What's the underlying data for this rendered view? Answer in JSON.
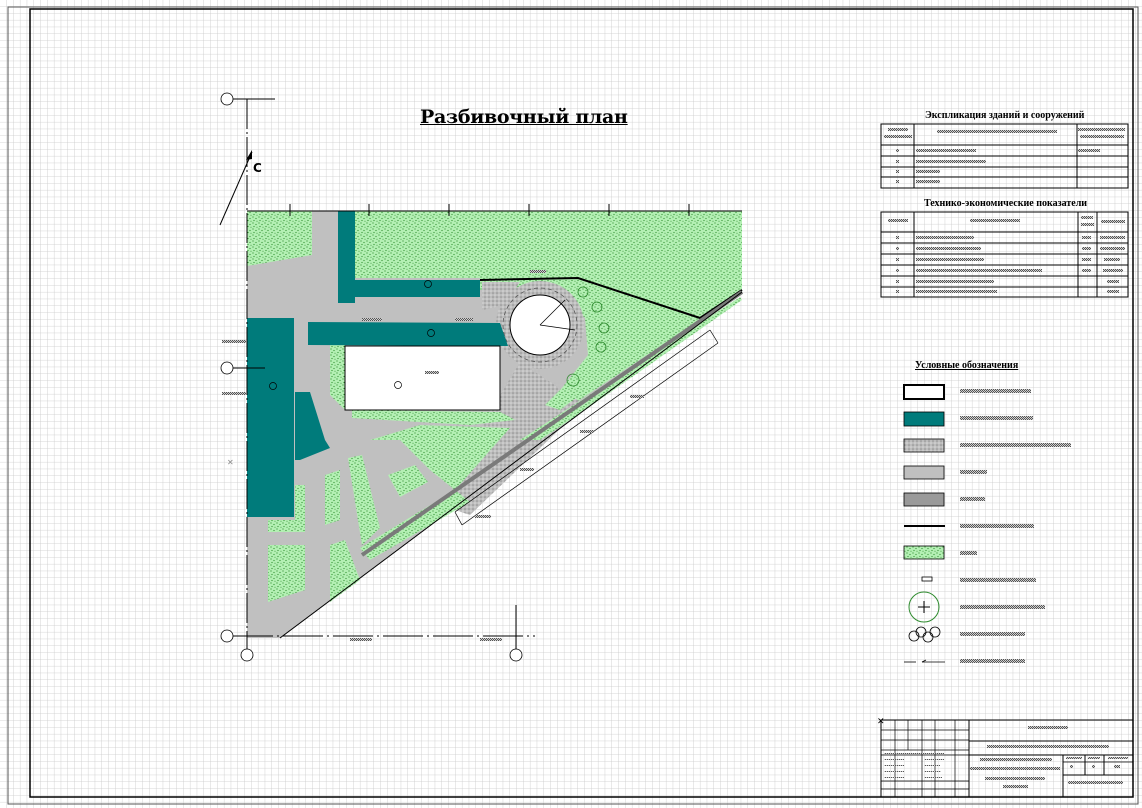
{
  "drawing": {
    "title": "Разбивочный план",
    "north_label": "С"
  },
  "explication_table": {
    "heading": "Экспликация зданий и сооружений",
    "row_count": 4
  },
  "tep_table": {
    "heading": "Технико-экономические показатели",
    "row_count": 6
  },
  "legend": {
    "heading": "Условные обозначения",
    "items": [
      {
        "symbol": "outlined-rectangle"
      },
      {
        "symbol": "teal-building"
      },
      {
        "symbol": "gravel-paving"
      },
      {
        "symbol": "light-gray-paving"
      },
      {
        "symbol": "dark-gray-paving"
      },
      {
        "symbol": "thick-line"
      },
      {
        "symbol": "lawn"
      },
      {
        "symbol": "bench"
      },
      {
        "symbol": "tree-circle"
      },
      {
        "symbol": "shrub-group"
      },
      {
        "symbol": "arrow-line"
      }
    ]
  },
  "colors": {
    "building": "#007b7b",
    "lawn": "#b4f0b4",
    "lawn_dots": "#2e8b2e",
    "paving": "#c0c0c0",
    "dark_paving": "#9a9a9a",
    "grid": "#c9c9c9"
  }
}
